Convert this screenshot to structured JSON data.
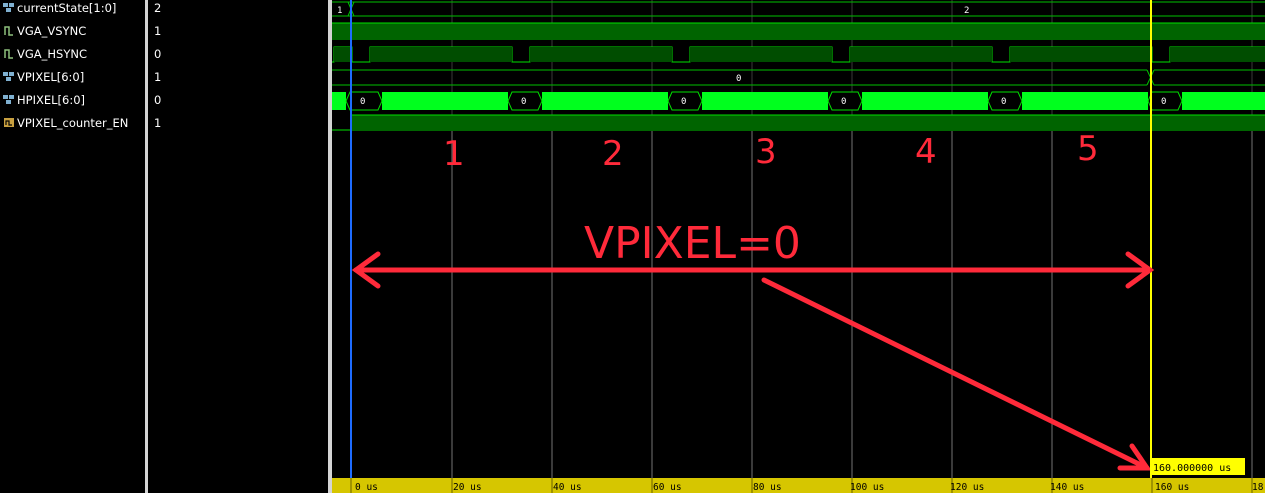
{
  "signals": [
    {
      "name": "currentState[1:0]",
      "value": "2",
      "icon": "bus-icon"
    },
    {
      "name": "VGA_VSYNC",
      "value": "1",
      "icon": "wire-icon"
    },
    {
      "name": "VGA_HSYNC",
      "value": "0",
      "icon": "wire-icon"
    },
    {
      "name": "VPIXEL[6:0]",
      "value": "1",
      "icon": "bus-icon"
    },
    {
      "name": "HPIXEL[6:0]",
      "value": "0",
      "icon": "bus-icon"
    },
    {
      "name": "VPIXEL_counter_EN",
      "value": "1",
      "icon": "reg-icon"
    }
  ],
  "waves": {
    "currentState_before": "1",
    "currentState_after": "2",
    "vpixel_value": "0",
    "hpixel_labels": [
      "0",
      "0",
      "0",
      "0",
      "0",
      "0"
    ]
  },
  "time_axis": {
    "ticks": [
      "0 us",
      "20 us",
      "40 us",
      "60 us",
      "80 us",
      "100 us",
      "120 us",
      "140 us",
      "160 us",
      "18"
    ]
  },
  "cursor": {
    "readout": "160.000000 us"
  },
  "annotations": {
    "numbers": [
      "1",
      "2",
      "3",
      "4",
      "5"
    ],
    "label": "VPIXEL=0"
  },
  "colors": {
    "wave_green": "#00e000",
    "bus_fill": "#00ff1e",
    "dark_fill": "#005a00",
    "cursor_yellow": "#ffff00",
    "marker_blue": "#1e6cff",
    "annotation_red": "#ff2a3a",
    "axis_bar": "#d6c600"
  }
}
